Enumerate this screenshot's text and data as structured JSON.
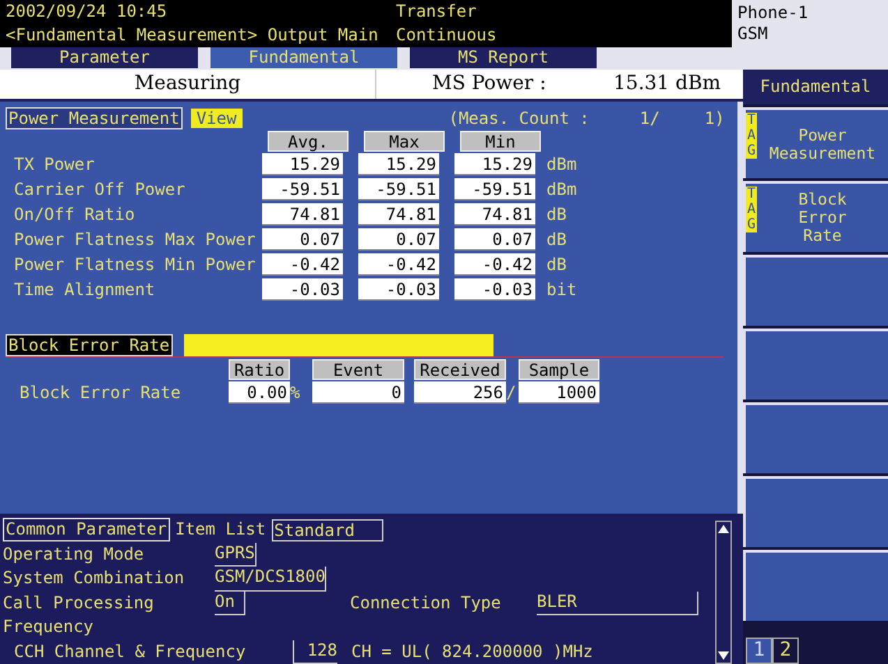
{
  "header": {
    "datetime": "2002/09/24 10:45",
    "screen": "<Fundamental Measurement> Output Main",
    "transfer": "Transfer",
    "mode": "Continuous",
    "phone": "Phone-1",
    "system": "GSM"
  },
  "tabs": [
    {
      "label": "Parameter",
      "selected": false
    },
    {
      "label": "Fundamental",
      "selected": true
    },
    {
      "label": "MS Report",
      "selected": false
    }
  ],
  "status": {
    "state": "Measuring",
    "label": "MS Power :",
    "value": "15.31 dBm"
  },
  "power_measurement": {
    "title": "Power Measurement",
    "view_button": "View",
    "count_label": "(Meas. Count :",
    "count_current": "1/",
    "count_total": "1)",
    "columns": [
      "Avg.",
      "Max",
      "Min"
    ],
    "rows": [
      {
        "label": "TX Power",
        "values": [
          "15.29",
          "15.29",
          "15.29"
        ],
        "unit": "dBm"
      },
      {
        "label": "Carrier Off Power",
        "values": [
          "-59.51",
          "-59.51",
          "-59.51"
        ],
        "unit": "dBm"
      },
      {
        "label": "On/Off Ratio",
        "values": [
          "74.81",
          "74.81",
          "74.81"
        ],
        "unit": "dB"
      },
      {
        "label": "Power Flatness Max Power",
        "values": [
          "0.07",
          "0.07",
          "0.07"
        ],
        "unit": "dB"
      },
      {
        "label": "Power Flatness Min Power",
        "values": [
          "-0.42",
          "-0.42",
          "-0.42"
        ],
        "unit": "dB"
      },
      {
        "label": "Time Alignment",
        "values": [
          "-0.03",
          "-0.03",
          "-0.03"
        ],
        "unit": "bit"
      }
    ]
  },
  "block_error_rate": {
    "title": "Block Error Rate",
    "columns": [
      "Ratio",
      "Event",
      "Received",
      "Sample"
    ],
    "row_label": "Block Error Rate",
    "ratio": "0.00",
    "percent": "%",
    "event": "0",
    "received": "256",
    "slash": "/",
    "sample": "1000"
  },
  "common_parameter": {
    "title": "Common Parameter",
    "item_list_label": "Item List",
    "item_list": "Standard",
    "operating_mode_label": "Operating Mode",
    "operating_mode": "GPRS",
    "system_combination_label": "System Combination",
    "system_combination": "GSM/DCS1800",
    "call_processing_label": "Call Processing",
    "call_processing": "On",
    "connection_type_label": "Connection Type",
    "connection_type": "BLER",
    "frequency_label": "Frequency",
    "cch_label": "CCH Channel & Frequency",
    "cch_channel": "128",
    "cch_value": "CH = UL( 824.200000 )MHz"
  },
  "function_keys": {
    "title": "Fundamental",
    "keys": [
      {
        "kind": "tagged",
        "label": "Power Measurement",
        "tag": "TAG"
      },
      {
        "kind": "tagged",
        "label": "Block Error Rate",
        "tag": "TAG"
      },
      {
        "kind": "blank"
      },
      {
        "kind": "blank"
      },
      {
        "kind": "blank"
      },
      {
        "kind": "blank"
      },
      {
        "kind": "blank"
      }
    ],
    "pages": [
      {
        "label": "1",
        "selected": true
      },
      {
        "label": "2",
        "selected": false
      }
    ]
  }
}
